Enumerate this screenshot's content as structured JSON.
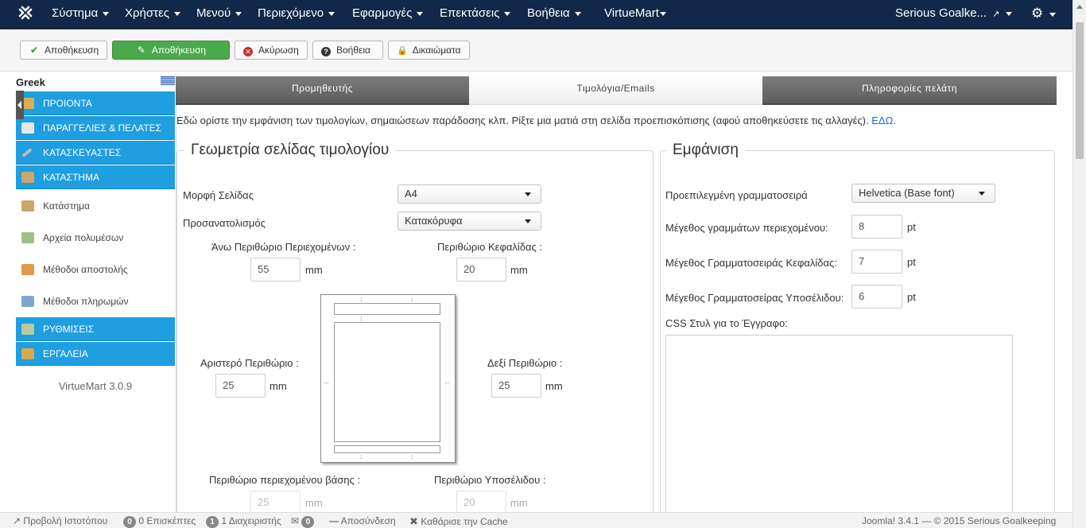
{
  "navbar": {
    "menu": [
      "Σύστημα",
      "Χρήστες",
      "Μενού",
      "Περιεχόμενο",
      "Εφαρμογές",
      "Επεκτάσεις",
      "Βοήθεια",
      "VirtueMart"
    ],
    "site_name": "Serious Goalke..."
  },
  "toolbar": {
    "save_label": "Αποθήκευση",
    "save_close_label": "Αποθήκευση",
    "cancel_label": "Ακύρωση",
    "help_label": "Βοήθεια",
    "permissions_label": "Δικαιώματα"
  },
  "sidebar": {
    "language": "Greek",
    "items": [
      {
        "label": "ΠΡΟΙΟΝΤΑ",
        "icon": "products-icon"
      },
      {
        "label": "ΠΑΡΑΓΓΕΛΙΕΣ & ΠΕΛΑΤΕΣ",
        "icon": "orders-icon"
      },
      {
        "label": "ΚΑΤΑΣΚΕΥΑΣΤΕΣ",
        "icon": "wrench-icon"
      },
      {
        "label": "ΚΑΤΑΣΤΗΜΑ",
        "icon": "shop-icon"
      }
    ],
    "sub_items": [
      {
        "label": "Κατάστημα",
        "icon": "shop-icon"
      },
      {
        "label": "Αρχεία πολυμέσων",
        "icon": "media-icon"
      },
      {
        "label": "Μέθοδοι αποστολής",
        "icon": "truck-icon"
      },
      {
        "label": "Μέθοδοι πληρωμών",
        "icon": "payment-icon"
      }
    ],
    "bottom_items": [
      {
        "label": "ΡΥΘΜΙΣΕΙΣ",
        "icon": "settings-icon"
      },
      {
        "label": "ΕΡΓΑΛΕΙΑ",
        "icon": "tools-icon"
      }
    ],
    "version": "VirtueMart 3.0.9"
  },
  "tabs": [
    "Προμηθευτής",
    "Τιμολόγια/Emails",
    "Πληροφορίες πελάτη"
  ],
  "intro": {
    "text": "Εδώ ορίστε την εμφάνιση των τιμολογίων, σημαιώσεων παράδοσης κλπ. Ρίξτε μια ματιά στη σελίδα προεπισκόπισης (αφού αποθηκεύσετε τις αλλαγές).",
    "link": "ΕΔΩ."
  },
  "geometry": {
    "legend": "Γεωμετρία σελίδας τιμολογίου",
    "format_label": "Μορφή Σελίδας",
    "format_value": "A4",
    "orientation_label": "Προσανατολισμός",
    "orientation_value": "Κατακόρυφα",
    "top_margin_label": "Άνω Περιθώριο Περιεχομένων :",
    "top_margin_value": "55",
    "header_margin_label": "Περιθώριο Κεφαλίδας :",
    "header_margin_value": "20",
    "left_margin_label": "Αριστερό Περιθώριο :",
    "left_margin_value": "25",
    "right_margin_label": "Δεξί Περιθώριο :",
    "right_margin_value": "25",
    "bottom_margin_label": "Περιθώριο περιεχομένου βάσης :",
    "bottom_margin_value": "25",
    "footer_margin_label": "Περιθώριο Υποσέλιδου :",
    "footer_margin_value": "20",
    "unit": "mm"
  },
  "appearance": {
    "legend": "Εμφάνιση",
    "font_label": "Προεπιλεγμένη γραμματοσειρά",
    "font_value": "Helvetica (Base font)",
    "content_size_label": "Μέγεθος γραμμάτων περιεχομένου:",
    "content_size_value": "8",
    "header_size_label": "Μέγεθος Γραμματοσειράς Κεφαλίδας:",
    "header_size_value": "7",
    "footer_size_label": "Μέγεθος Γραμματοσείρας Υποσέλιδου:",
    "footer_size_value": "6",
    "unit": "pt",
    "css_label": "CSS Στυλ για το Έγγραφο:"
  },
  "statusbar": {
    "view_site": "Προβολή Ιστοτόπου",
    "visitors_count": "0",
    "visitors_label": "0 Επισκέπτες",
    "admins_count": "1",
    "admins_label": "1 Διαχειριστής",
    "messages_count": "0",
    "logout": "Αποσύνδεση",
    "clear_cache": "Καθάρισε την Cache",
    "footer": "Joomla! 3.4.1 — © 2015 Serious Goalkeeping"
  },
  "colors": {
    "navbar": "#12284a",
    "accent_blue": "#1f9ee0",
    "save_green": "#4aa94a",
    "link": "#1b6cc9"
  }
}
